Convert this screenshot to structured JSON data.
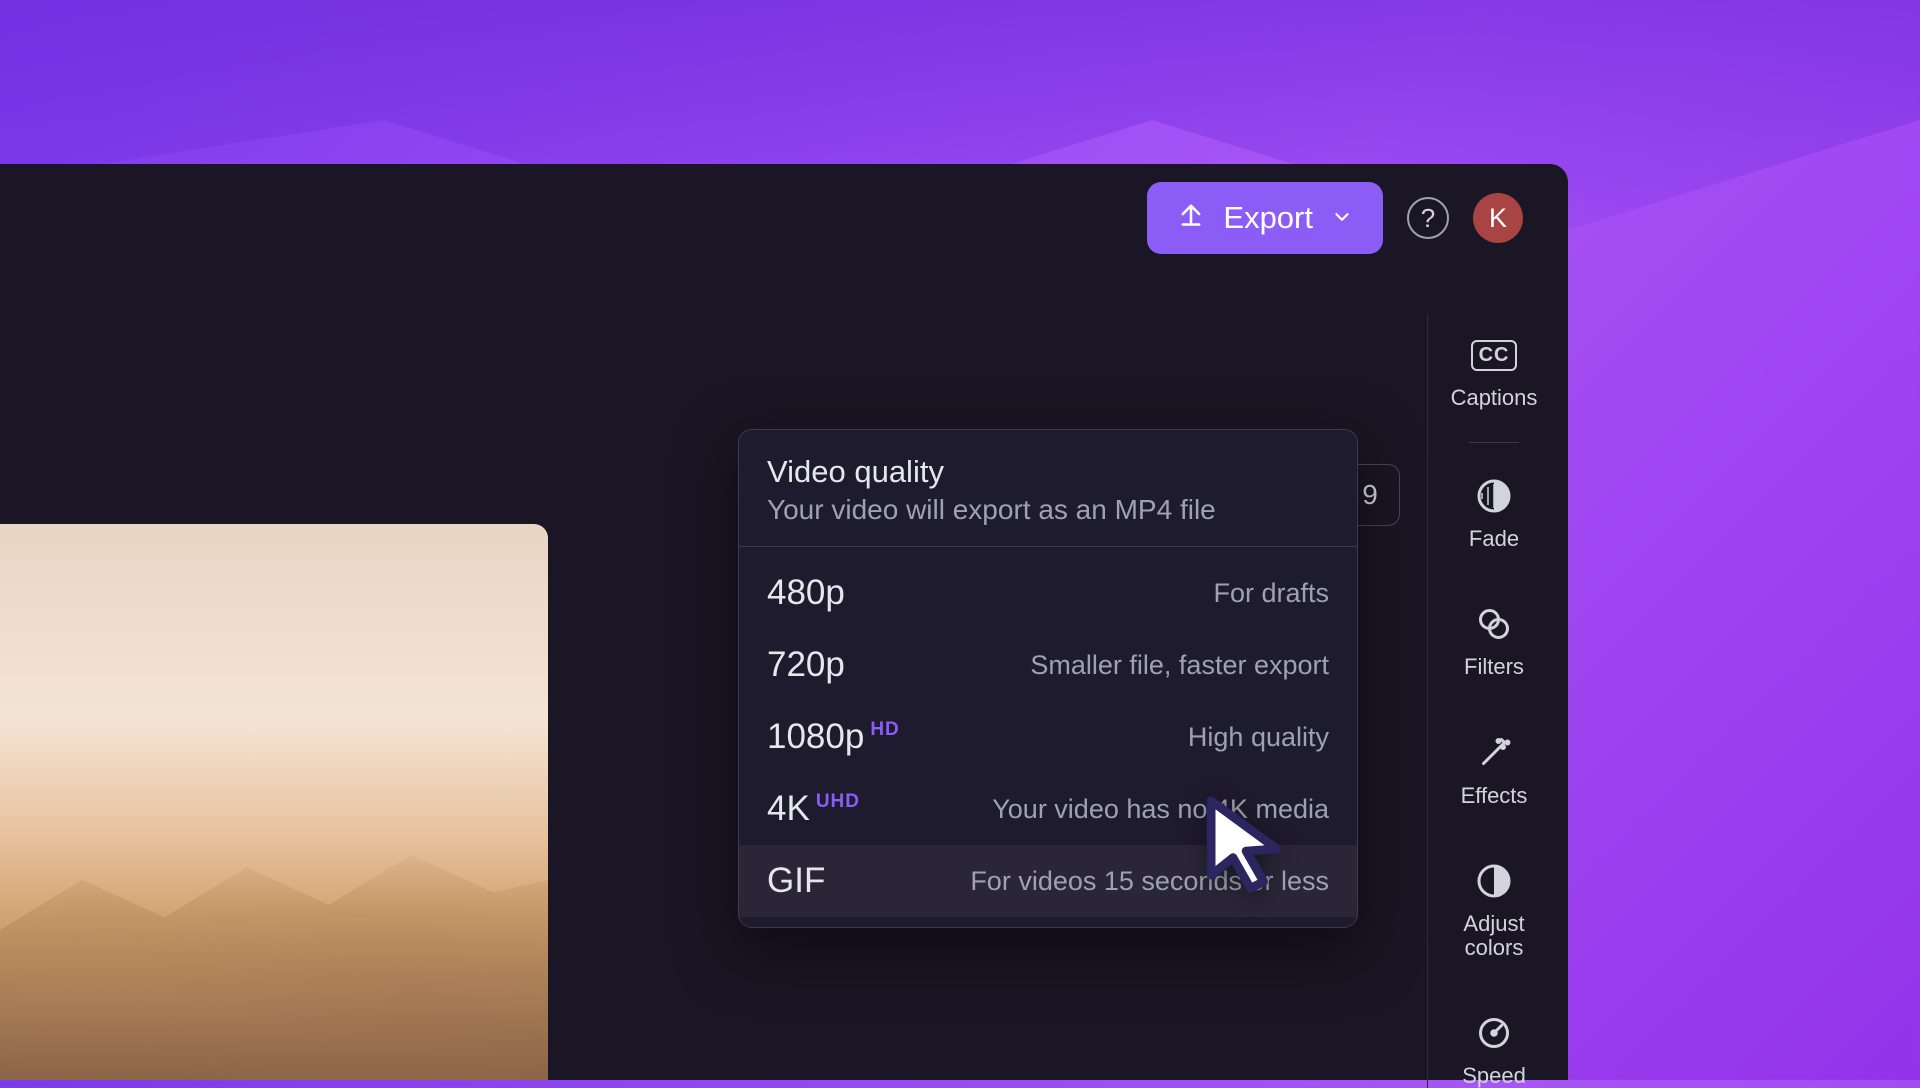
{
  "toolbar": {
    "export_label": "Export",
    "avatar_initial": "K"
  },
  "hidden_badge": "9",
  "dropdown": {
    "title": "Video quality",
    "subtitle": "Your video will export as an MP4 file",
    "options": [
      {
        "name": "480p",
        "badge": "",
        "desc": "For drafts",
        "hovered": false
      },
      {
        "name": "720p",
        "badge": "",
        "desc": "Smaller file, faster export",
        "hovered": false
      },
      {
        "name": "1080p",
        "badge": "HD",
        "desc": "High quality",
        "hovered": false
      },
      {
        "name": "4K",
        "badge": "UHD",
        "desc": "Your video has no 4K media",
        "hovered": false
      },
      {
        "name": "GIF",
        "badge": "",
        "desc": "For videos 15 seconds or less",
        "hovered": true
      }
    ]
  },
  "sidebar": {
    "items": [
      {
        "label": "Captions",
        "icon": "cc-icon"
      },
      {
        "label": "Fade",
        "icon": "fade-icon"
      },
      {
        "label": "Filters",
        "icon": "filters-icon"
      },
      {
        "label": "Effects",
        "icon": "effects-icon"
      },
      {
        "label": "Adjust colors",
        "icon": "adjust-icon"
      },
      {
        "label": "Speed",
        "icon": "speed-icon"
      }
    ]
  },
  "colors": {
    "accent": "#8b5cf6",
    "panel": "#1a1625",
    "dropdown": "#1f1b2e",
    "text": "#e5e7eb",
    "muted": "#9ca3af"
  }
}
